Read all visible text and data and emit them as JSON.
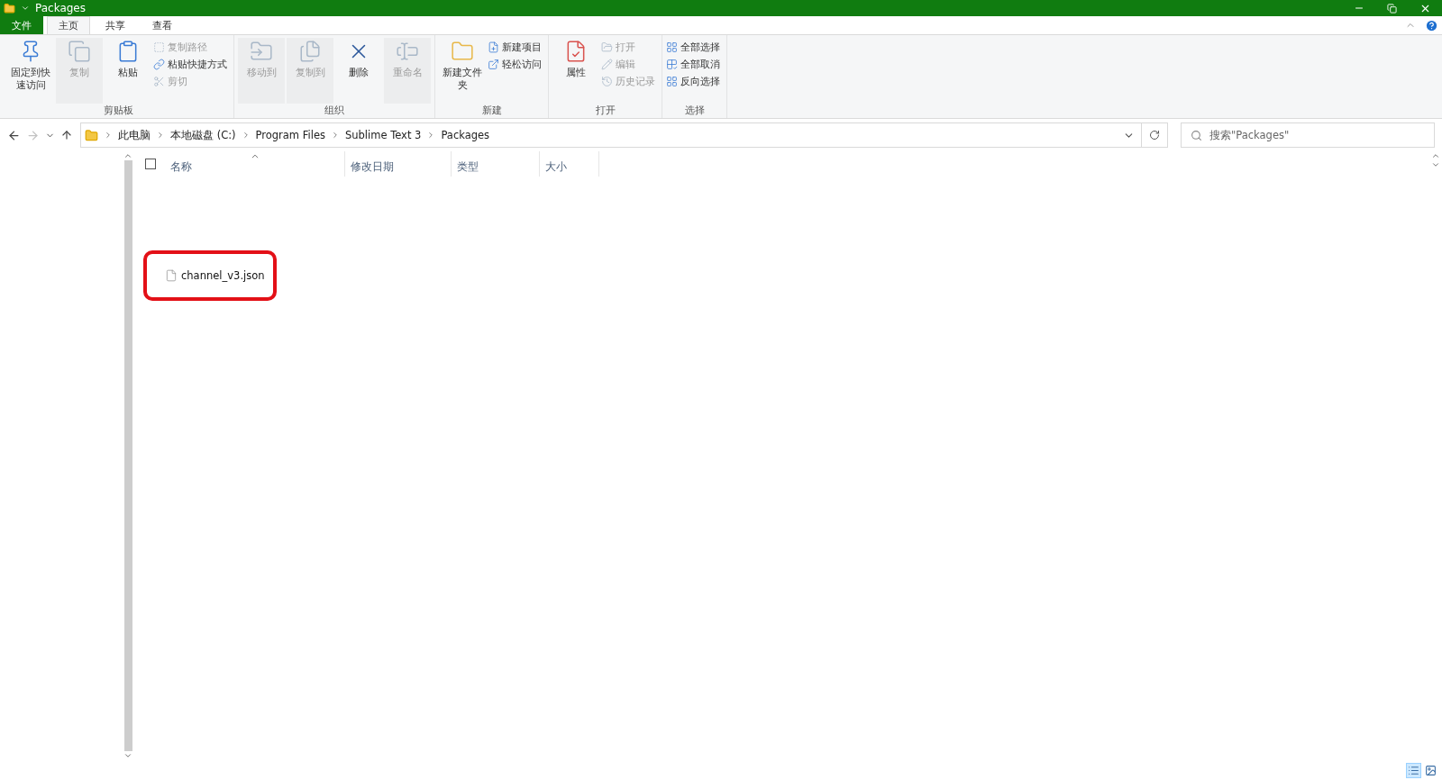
{
  "window": {
    "title": "Packages"
  },
  "tabs": [
    {
      "label": "文件",
      "kind": "file",
      "selected": false
    },
    {
      "label": "主页",
      "kind": "tab",
      "selected": true
    },
    {
      "label": "共享",
      "kind": "tab",
      "selected": false
    },
    {
      "label": "查看",
      "kind": "tab",
      "selected": false
    }
  ],
  "ribbon": {
    "groups": [
      {
        "label": "剪贴板",
        "items": [
          {
            "label": "固定到快速访问",
            "kind": "large",
            "disabled": false
          },
          {
            "label": "复制",
            "kind": "large",
            "disabled": true
          },
          {
            "label": "粘贴",
            "kind": "large",
            "disabled": false
          },
          {
            "label": "复制路径",
            "kind": "small",
            "disabled": true
          },
          {
            "label": "粘贴快捷方式",
            "kind": "small",
            "disabled": false
          },
          {
            "label": "剪切",
            "kind": "small",
            "disabled": true
          }
        ]
      },
      {
        "label": "组织",
        "items": [
          {
            "label": "移动到",
            "kind": "large",
            "disabled": true
          },
          {
            "label": "复制到",
            "kind": "large",
            "disabled": true
          },
          {
            "label": "删除",
            "kind": "large",
            "disabled": false
          },
          {
            "label": "重命名",
            "kind": "large",
            "disabled": true
          }
        ]
      },
      {
        "label": "新建",
        "items": [
          {
            "label": "新建文件夹",
            "kind": "large",
            "disabled": false
          },
          {
            "label": "新建项目",
            "kind": "small",
            "disabled": false
          },
          {
            "label": "轻松访问",
            "kind": "small",
            "disabled": false
          }
        ]
      },
      {
        "label": "打开",
        "items": [
          {
            "label": "属性",
            "kind": "large",
            "disabled": false
          },
          {
            "label": "打开",
            "kind": "small",
            "disabled": true
          },
          {
            "label": "编辑",
            "kind": "small",
            "disabled": true
          },
          {
            "label": "历史记录",
            "kind": "small",
            "disabled": true
          }
        ]
      },
      {
        "label": "选择",
        "items": [
          {
            "label": "全部选择",
            "kind": "small",
            "disabled": false
          },
          {
            "label": "全部取消",
            "kind": "small",
            "disabled": false
          },
          {
            "label": "反向选择",
            "kind": "small",
            "disabled": false
          }
        ]
      }
    ]
  },
  "address": {
    "path": [
      "此电脑",
      "本地磁盘 (C:)",
      "Program Files",
      "Sublime Text 3",
      "Packages"
    ]
  },
  "search": {
    "placeholder": "搜索\"Packages\""
  },
  "table": {
    "select_all": {
      "checked": false
    },
    "columns": [
      {
        "label": "名称",
        "sorted": true
      },
      {
        "label": "修改日期",
        "sorted": false
      },
      {
        "label": "类型",
        "sorted": false
      },
      {
        "label": "大小",
        "sorted": false
      }
    ]
  },
  "files": [
    {
      "name": "channel_v3.json",
      "highlighted": true
    }
  ],
  "views": [
    {
      "kind": "details",
      "selected": true
    },
    {
      "kind": "tiles",
      "selected": false
    }
  ]
}
